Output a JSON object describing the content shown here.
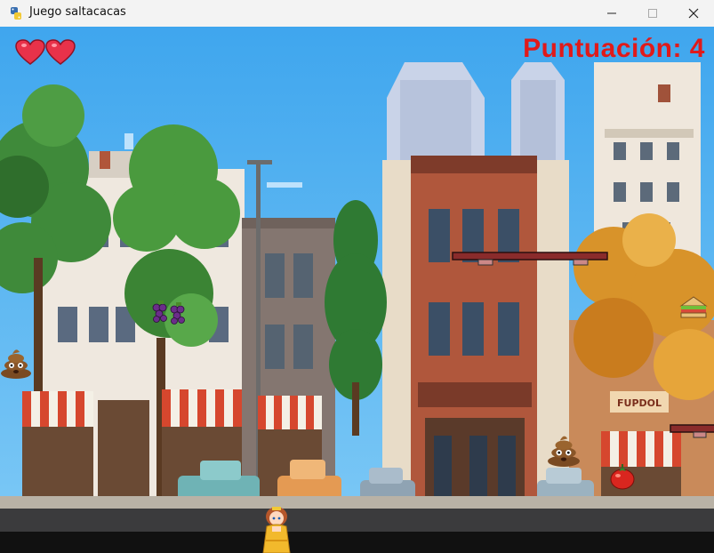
{
  "window": {
    "title": "Juego saltacacas",
    "app_icon": "python-icon",
    "controls": [
      "minimize-icon",
      "maximize-icon",
      "close-icon"
    ]
  },
  "hud": {
    "lives": 2,
    "score_text": "Puntuación: 4"
  },
  "scene": {
    "background": "pixel-art city street with trees, brick buildings and parked cars",
    "player": "princess-character",
    "items": [
      "grapes",
      "sandwich",
      "tomato",
      "poop",
      "poop"
    ],
    "platforms": 2
  },
  "colors": {
    "score": "#e01a1a",
    "heart": "#e8324a",
    "sky": "#4fb3f0",
    "road": "#3b3b3d"
  }
}
